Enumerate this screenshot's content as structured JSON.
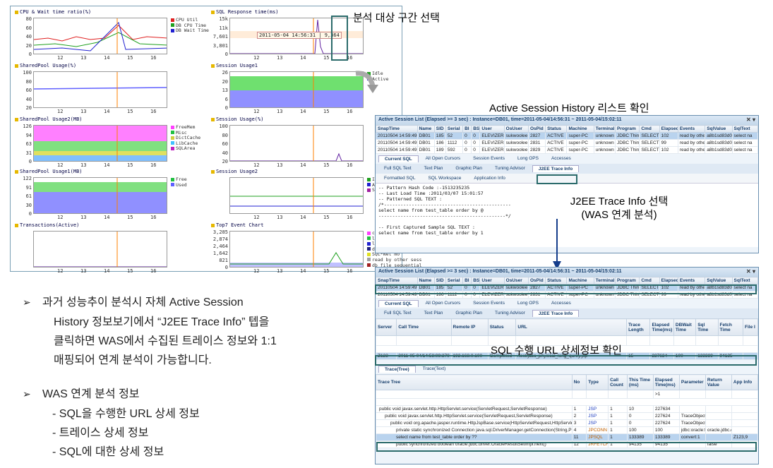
{
  "callouts": {
    "analysis_range": "분석 대상 구간 선택",
    "ash_list": "Active Session History 리스트 확인",
    "j2ee_line1": "J2EE Trace Info 선택",
    "j2ee_line2": "(WAS 연계 분석)",
    "sql_url": "SQL 수행 URL 상세정보 확인"
  },
  "dashboard": {
    "x_ticks": [
      "12",
      "13",
      "14",
      "15",
      "16"
    ],
    "panels": [
      {
        "title": "CPU & Wait time ratio(%)",
        "y_ticks": [
          "80",
          "60",
          "40",
          "20",
          "0"
        ],
        "legend": [
          {
            "label": "CPU Util",
            "color": "#e02020"
          },
          {
            "label": "DB CPU Time",
            "color": "#20a020"
          },
          {
            "label": "DB Wait Time",
            "color": "#2020d0"
          }
        ]
      },
      {
        "title": "SQL Response time(ms)",
        "y_ticks": [
          "15k",
          "11k",
          "7,601",
          "3,801",
          "0"
        ],
        "tooltip": "2011-05-04 14:56:31 | 9,364",
        "legend": []
      },
      {
        "title": "SharedPool Usage(%)",
        "y_ticks": [
          "100",
          "80",
          "60",
          "40",
          "20"
        ],
        "legend": []
      },
      {
        "title": "Session Usage1",
        "y_ticks": [
          "26",
          "20",
          "13",
          "6",
          "0"
        ],
        "legend": [
          {
            "label": "Idle",
            "color": "#20a020"
          },
          {
            "label": "Active",
            "color": "#2020d0"
          }
        ]
      },
      {
        "title": "SharedPool Usage2(MB)",
        "y_ticks": [
          "126",
          "94",
          "63",
          "31",
          "0"
        ],
        "legend": [
          {
            "label": "FreeMem",
            "color": "#ff40ff"
          },
          {
            "label": "Misc",
            "color": "#20c040"
          },
          {
            "label": "DictCache",
            "color": "#cfcf40"
          },
          {
            "label": "LibCache",
            "color": "#40c0ff"
          },
          {
            "label": "SQLArea",
            "color": "#c020c0"
          }
        ]
      },
      {
        "title": "Session Usage(%)",
        "y_ticks": [
          "100",
          "80",
          "60",
          "40",
          "20"
        ],
        "legend": []
      },
      {
        "title": "SharedPool Usage1(MB)",
        "y_ticks": [
          "122",
          "91",
          "61",
          "30",
          "0"
        ],
        "legend": [
          {
            "label": "Free",
            "color": "#20c040"
          },
          {
            "label": "Used",
            "color": "#6060ff"
          }
        ]
      },
      {
        "title": "Session Usage2",
        "y_ticks": [
          "",
          "",
          "",
          "",
          ""
        ],
        "legend": [
          {
            "label": "Idle",
            "color": "#20a020"
          },
          {
            "label": "Active",
            "color": "#2020d0"
          },
          {
            "label": "System",
            "color": "#a020a0"
          }
        ]
      },
      {
        "title": "Transactions(Active)",
        "y_ticks": [
          "",
          "",
          "",
          "",
          ""
        ],
        "legend": []
      },
      {
        "title": "Top7 Event Chart",
        "y_ticks": [
          "3,285",
          "2,874",
          "2,464",
          "1,642",
          "821",
          "0"
        ],
        "legend": [
          {
            "label": "control file",
            "color": "#ff40ff"
          },
          {
            "label": "log file sy",
            "color": "#20c040"
          },
          {
            "label": "log file pa",
            "color": "#2020d0"
          },
          {
            "label": "db file sca",
            "color": "#202080"
          },
          {
            "label": "SQL*Net mo",
            "color": "#e0e020"
          },
          {
            "label": "read by other sess",
            "color": "#a0a0a0"
          },
          {
            "label": "db file sequential",
            "color": "#a02020"
          }
        ]
      }
    ]
  },
  "win1": {
    "title": "Active Session List (Elapsed >= 3 sec) : Instance=DB01, time=2011-05-04/14:56:31 ~ 2011-05-04/15:02:11",
    "columns": [
      "SnapTime",
      "Name",
      "SID",
      "Serial",
      "BI",
      "BS",
      "User",
      "OsUser",
      "OsPid",
      "Status",
      "Machine",
      "Terminal",
      "Program",
      "Cmd",
      "Elapsed",
      "Events",
      "SqlValue",
      "SqlText"
    ],
    "rows": [
      [
        "20110504 14:59:49",
        "DB01",
        "185",
        "52",
        "0",
        "0",
        "ELEVIZER",
        "sukwoolee",
        "2827",
        "ACTIVE",
        "super-PC",
        "unknown",
        "JDBC Thin C",
        "SELECT",
        "102",
        "read by othe",
        "a8b1sd83d0x",
        "select na"
      ],
      [
        "20110504 14:59:49",
        "DB01",
        "186",
        "1112",
        "0",
        "0",
        "ELEVIZER",
        "sukwoolee",
        "2831",
        "ACTIVE",
        "super-PC",
        "unknown",
        "JDBC Thin C",
        "SELECT",
        "99",
        "read by othe",
        "a8b1sd83d0x",
        "select na"
      ],
      [
        "20110504 14:59:49",
        "DB01",
        "189",
        "592",
        "0",
        "0",
        "ELEVIZER",
        "sukwoolee",
        "2829",
        "ACTIVE",
        "super-PC",
        "unknown",
        "JDBC Thin C",
        "SELECT",
        "102",
        "read by othe",
        "a8b1sd83d0x",
        "select na"
      ]
    ],
    "tabs1": [
      "Current SQL",
      "All Open Cursors",
      "Session Events",
      "Long OPS",
      "Accesses"
    ],
    "tabs2": [
      "Full SQL Text",
      "Text Plan",
      "Graphic Plan",
      "Tuning Advisor",
      "J2EE Trace Info"
    ],
    "toolbar": [
      "Formatted SQL",
      "SQL Workspace",
      "Application Info"
    ],
    "code": "-- Pattern Hash Code :-1513235235\n-- Last Load Time :2011/03/07 15:01:57\n-- Patterned SQL TEXT :\n/*----------------------------------------------\nselect name from test_table order by @\n----------------------------------------------*/\n\n-- First Captured Sample SQL TEXT :\nselect name from test_table order by 1"
  },
  "win2": {
    "title": "Active Session List (Elapsed >= 3 sec) : Instance=DB01, time=2011-05-04/14:56:31 ~ 2011-05-04/15:02:11",
    "row_selected": [
      "20110504 14:59:49",
      "DB01",
      "185",
      "52",
      "0",
      "0",
      "ELEVIZER",
      "sukwoolee",
      "2827",
      "ACTIVE",
      "super-PC",
      "unknown",
      "JDBC Thin C",
      "SELECT",
      "102",
      "read by othe",
      "a8b1sd83d0x",
      "select na"
    ],
    "row2": [
      "20110504 14:59:49",
      "DB01",
      "186",
      "1112",
      "0",
      "0",
      "ELEVIZER",
      "sukwoolee",
      "2831",
      "ACTIVE",
      "super-PC",
      "unknown",
      "JDBC Thin C",
      "SELECT",
      "99",
      "read by othe",
      "a8b1sd83d0x",
      "select na"
    ],
    "trace_columns": [
      "Server",
      "Call Time",
      "Remote IP",
      "Status",
      "URL",
      "Trace Length",
      "Elapsed Time(ms)",
      "DBWait Time",
      "Sql Time",
      "Fetch Time",
      "File I"
    ],
    "trace_row": [
      "Z123",
      "2011-05-04/14:58:09:370",
      "192.168.0.100",
      "Completed",
      "/test/jdbc_physical_long_qurey.jsp",
      "15",
      "227634",
      "100",
      "133389",
      "94135",
      ""
    ],
    "tree_tabs": [
      "Trace(Tree)",
      "Trace(Text)"
    ],
    "tree_columns": [
      "Trace Tree",
      "No",
      "Type",
      "Call Count",
      "This Time (ms)",
      "Elapsed Time(ms)",
      "Parameter",
      "Return Value",
      "App Info"
    ],
    "filter_value": ">1",
    "tree_rows": [
      [
        "public void javax.servlet.http.HttpServlet.service(ServletRequest,ServletResponse)",
        "1",
        "JSP",
        "1",
        "10",
        "227634",
        "",
        "",
        ""
      ],
      [
        "public void javax.servlet.http.HttpServlet.service(ServletRequest,ServletResponse)",
        "2",
        "JSP",
        "1",
        "0",
        "227624",
        "TraceObjects",
        "",
        ""
      ],
      [
        "public void org.apache.jasper.runtime.HttpJspBase.service(HttpServletRequest,HttpServlet",
        "3",
        "JSP",
        "1",
        "0",
        "227624",
        "TraceObjects",
        "",
        ""
      ],
      [
        "private static synchronized Connection java.sql.DriverManager.getConnection(String,Pr",
        "4",
        "JPCONN",
        "1",
        "100",
        "100",
        "jdbc:oracle:thin:",
        "oracle.jdbc.dr",
        ""
      ],
      [
        "select name from test_table order by ??",
        "11",
        "JPSQL",
        "1",
        "133389",
        "133389",
        "convert:1",
        "",
        "Z123,9"
      ],
      [
        "public synchronized boolean oracle.jdbc.driver.OracleResultSetImpl.next()",
        "12",
        "JRFETCH",
        "1",
        "94135",
        "94135",
        "",
        "false",
        ""
      ]
    ]
  },
  "bullets": {
    "b1_l1": "과거 성능추이 분석시 자체 Active Session",
    "b1_l2": "History 정보보기에서 “J2EE Trace Info” 텝을",
    "b1_l3": "클릭하면 WAS에서 수집된 트레이스 정보와 1:1",
    "b1_l4": "매핑되어 연계 분석이 가능합니다.",
    "b2_title": "WAS 연계 분석 정보",
    "b2_i1": "- SQL을 수행한 URL  상세 정보",
    "b2_i2": "- 트레이스 상세 정보",
    "b2_i3": "- SQL에 대한 상세 정보"
  }
}
